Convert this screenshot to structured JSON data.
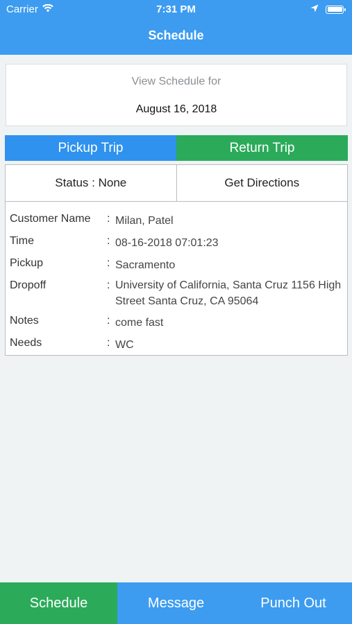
{
  "status_bar": {
    "carrier": "Carrier",
    "time": "7:31 PM"
  },
  "nav": {
    "title": "Schedule"
  },
  "date_picker": {
    "label": "View Schedule for",
    "value": "August 16, 2018"
  },
  "trip_tabs": [
    {
      "label": "Pickup Trip"
    },
    {
      "label": "Return Trip"
    }
  ],
  "trip": {
    "status": "Status : None",
    "directions": "Get Directions",
    "details": [
      {
        "label": "Customer Name",
        "value": "Milan, Patel"
      },
      {
        "label": "Time",
        "value": "08-16-2018 07:01:23"
      },
      {
        "label": "Pickup",
        "value": "Sacramento"
      },
      {
        "label": "Dropoff",
        "value": "University of California, Santa Cruz 1156 High Street Santa Cruz, CA 95064"
      },
      {
        "label": "Notes",
        "value": "come fast"
      },
      {
        "label": "Needs",
        "value": "WC"
      }
    ]
  },
  "bottom_nav": [
    {
      "label": "Schedule"
    },
    {
      "label": "Message"
    },
    {
      "label": "Punch Out"
    }
  ],
  "colors": {
    "primary_blue": "#3d9cf0",
    "tab_blue": "#2f92ee",
    "green": "#2bab5a",
    "background": "#eff3f4"
  }
}
